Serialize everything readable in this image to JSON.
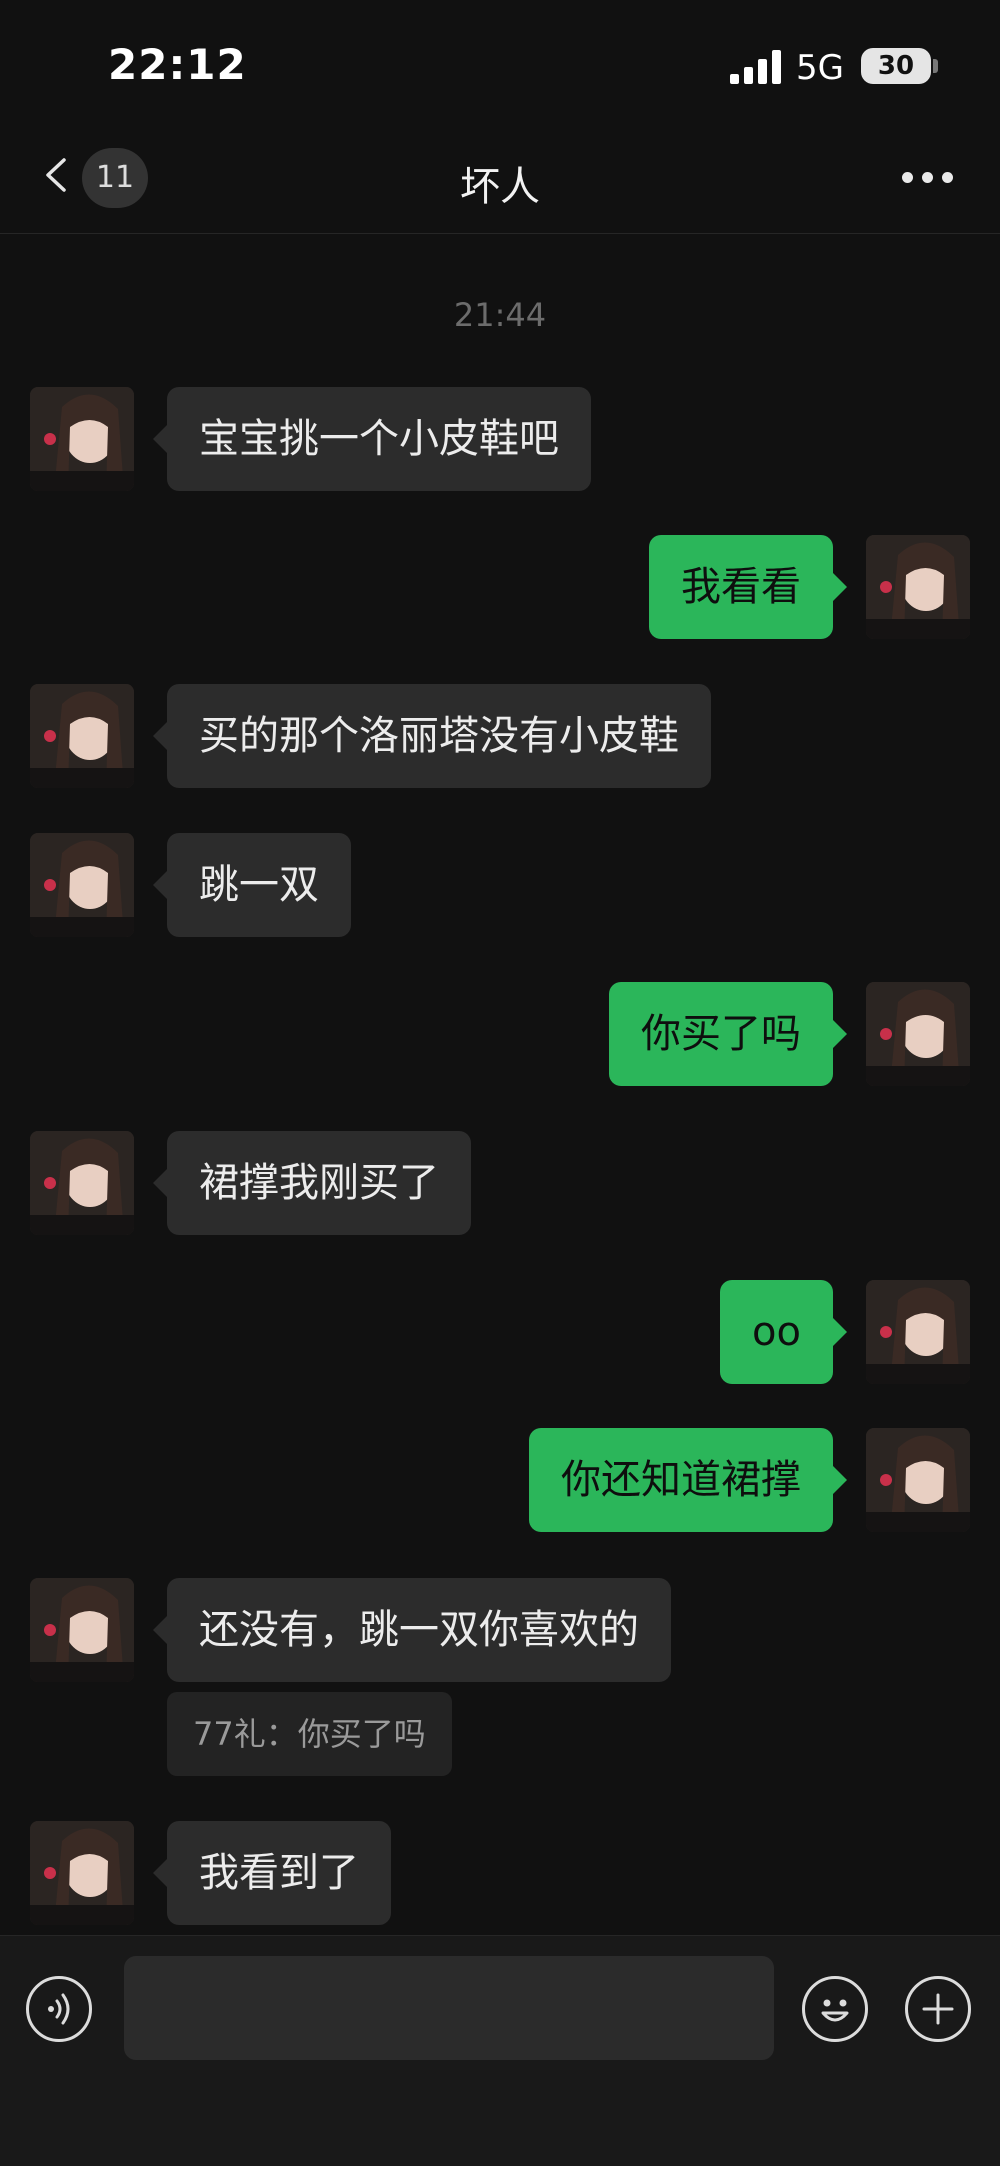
{
  "status_bar": {
    "time": "22:12",
    "network": "5G",
    "battery": "30"
  },
  "nav": {
    "unread_count": "11",
    "title": "坏人"
  },
  "chat": {
    "timestamp": "21:44",
    "messages": [
      {
        "side": "left",
        "text": "宝宝挑一个小皮鞋吧"
      },
      {
        "side": "right",
        "text": "我看看"
      },
      {
        "side": "left",
        "text": "买的那个洛丽塔没有小皮鞋"
      },
      {
        "side": "left",
        "text": "跳一双"
      },
      {
        "side": "right",
        "text": "你买了吗"
      },
      {
        "side": "left",
        "text": "裙撑我刚买了"
      },
      {
        "side": "right",
        "text": "oo"
      },
      {
        "side": "right",
        "text": "你还知道裙撑"
      },
      {
        "side": "left",
        "text": "还没有，跳一双你喜欢的",
        "quote": "77礼：你买了吗"
      },
      {
        "side": "left",
        "text": "我看到了"
      }
    ]
  },
  "input_bar": {
    "value": ""
  },
  "colors": {
    "background": "#111111",
    "my_bubble": "#2bb65a",
    "their_bubble": "#2c2c2c"
  },
  "icons": [
    "back-icon",
    "more-icon",
    "voice-icon",
    "microphone-icon",
    "emoji-icon",
    "plus-icon"
  ]
}
